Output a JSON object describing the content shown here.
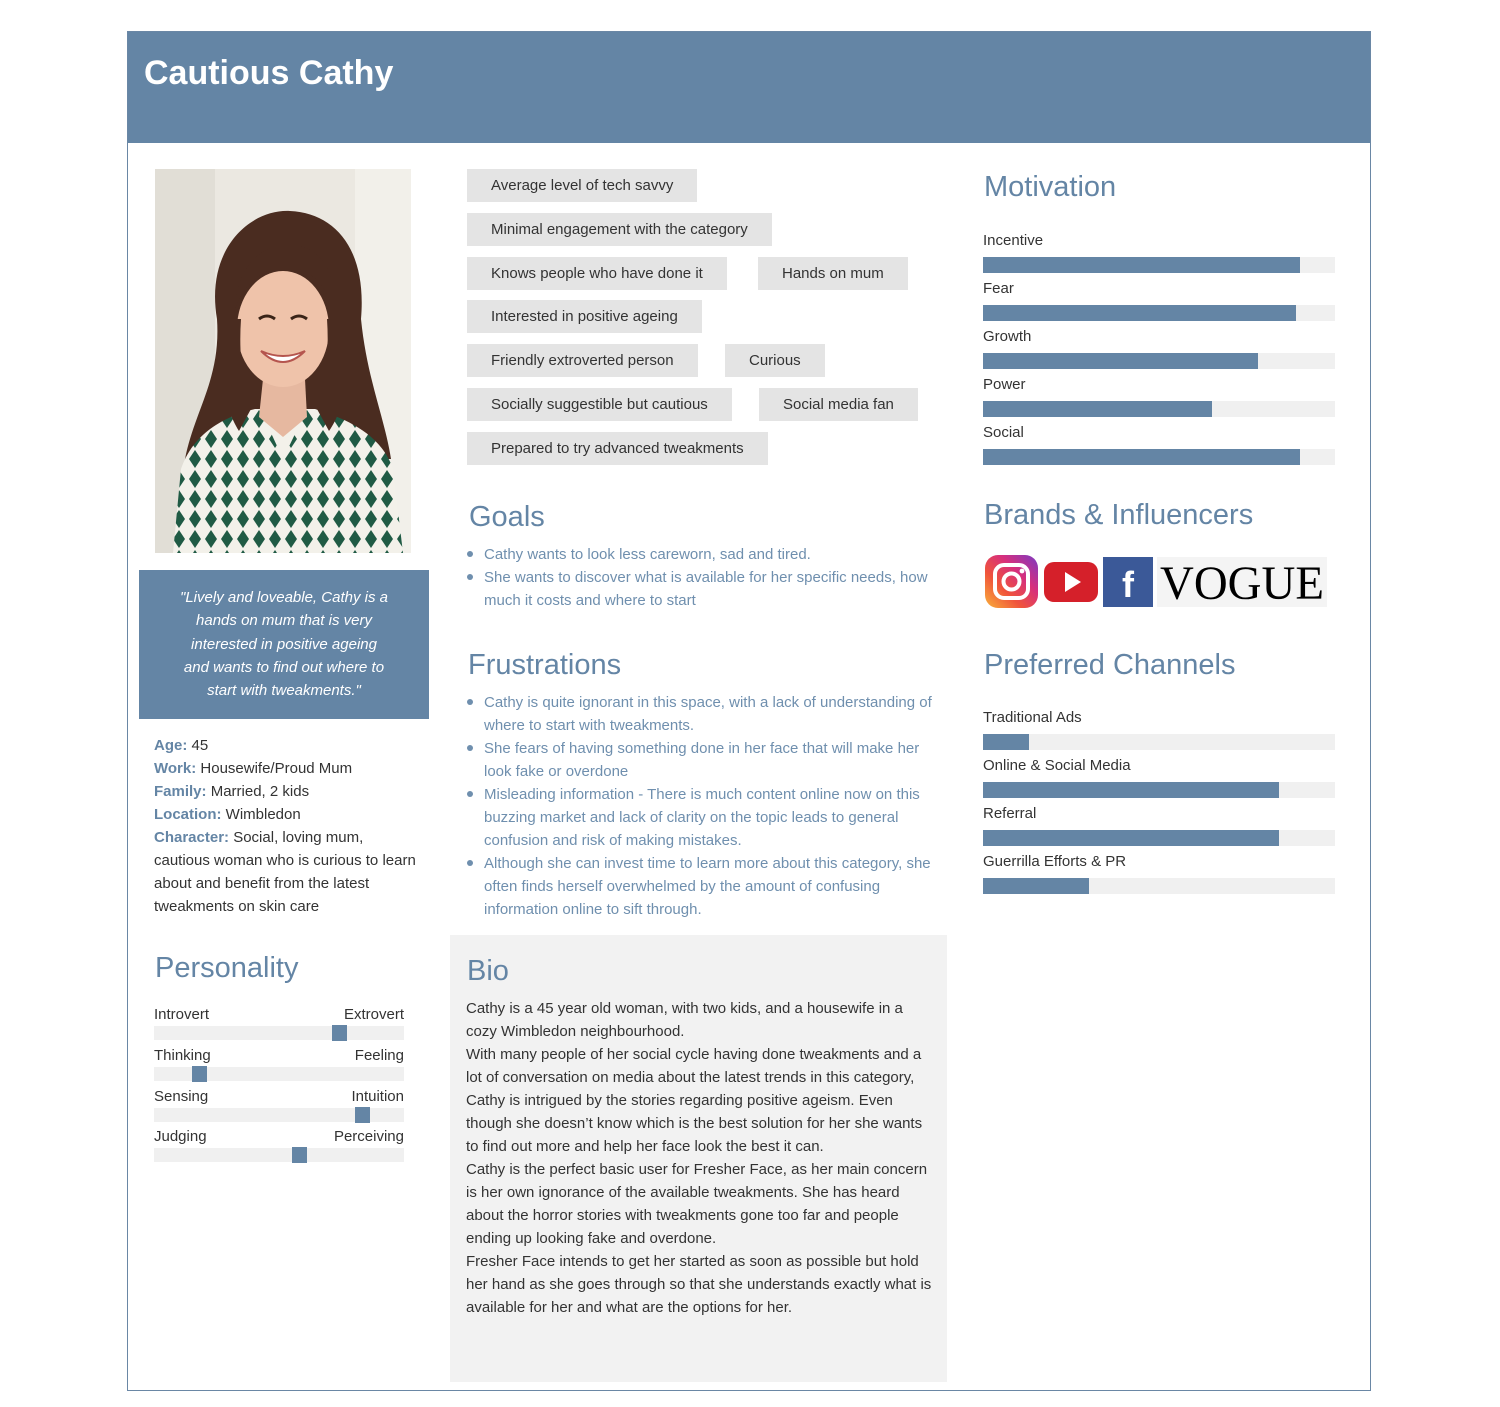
{
  "persona": {
    "name": "Cautious Cathy"
  },
  "quote": "\"Lively and loveable, Cathy is a hands on mum that is very interested in positive ageing and wants to find out where to start with tweakments.\"",
  "facts": [
    {
      "label": "Age",
      "value": " 45"
    },
    {
      "label": "Work",
      "value": " Housewife/Proud Mum"
    },
    {
      "label": "Family",
      "value": " Married, 2 kids"
    },
    {
      "label": "Location",
      "value": " Wimbledon"
    },
    {
      "label": "Character",
      "value": " Social, loving mum, cautious woman who is curious to learn about and benefit from the latest tweakments on skin care"
    }
  ],
  "personality": {
    "title": "Personality",
    "scales": [
      {
        "left": "Introvert",
        "right": "Extrovert",
        "value": 0.74
      },
      {
        "left": "Thinking",
        "right": "Feeling",
        "value": 0.18
      },
      {
        "left": "Sensing",
        "right": "Intuition",
        "value": 0.83
      },
      {
        "left": "Judging",
        "right": "Perceiving",
        "value": 0.58
      }
    ]
  },
  "tags": [
    "Average level of tech savvy",
    "Minimal engagement with the category",
    "Knows people who have done it",
    "Hands on mum",
    "Interested in positive ageing",
    "Friendly extroverted person",
    "Curious",
    "Socially suggestible but cautious",
    "Social media fan",
    "Prepared to try advanced tweakments"
  ],
  "goals": {
    "title": "Goals",
    "items": [
      "Cathy wants to look less careworn, sad and tired.",
      "She wants to discover what is available for her specific needs, how much it costs and where to start"
    ]
  },
  "frustrations": {
    "title": "Frustrations",
    "items": [
      "Cathy is quite ignorant in this space, with a lack of understanding of where to start with tweakments.",
      "She fears of having something done in her face that will make her look fake or overdone",
      "Misleading information - There is much content online now on this buzzing market and lack of clarity on the topic leads to general confusion and risk of making mistakes.",
      "Although she can invest time to learn more about this category, she often finds herself overwhelmed by the amount of confusing information online to sift through."
    ]
  },
  "bio": {
    "title": "Bio",
    "paragraphs": [
      "Cathy is a 45 year old woman, with two kids, and a housewife in a cozy Wimbledon neighbourhood.",
      "With many people of her social cycle having done tweakments and a lot of conversation on media about the latest trends in this category, Cathy is intrigued by the stories regarding positive ageism. Even though she doesn’t know which is the best solution for her she wants to find out more and help her face look the best it can.",
      "Cathy is the perfect basic user for Fresher Face, as her main concern is her own ignorance of the available tweakments. She has heard about the horror stories with tweakments gone too far and people ending up looking fake and overdone.",
      "Fresher Face intends to get her started as soon as possible but hold her hand as she goes through so that she understands exactly what is available for her and what are the options for her."
    ]
  },
  "motivation": {
    "title": "Motivation",
    "items": [
      {
        "label": "Incentive",
        "value": 0.9
      },
      {
        "label": "Fear",
        "value": 0.89
      },
      {
        "label": "Growth",
        "value": 0.78
      },
      {
        "label": "Power",
        "value": 0.65
      },
      {
        "label": "Social",
        "value": 0.9
      }
    ]
  },
  "brands": {
    "title": "Brands & Influencers",
    "logos": [
      "instagram-icon",
      "youtube-icon",
      "facebook-icon",
      "vogue-logo"
    ],
    "vogue_text": "VOGUE",
    "facebook_text": "f"
  },
  "channels": {
    "title": "Preferred Channels",
    "items": [
      {
        "label": "Traditional Ads",
        "value": 0.13
      },
      {
        "label": "Online & Social Media",
        "value": 0.84
      },
      {
        "label": "Referral",
        "value": 0.84
      },
      {
        "label": "Guerrilla Efforts & PR",
        "value": 0.3
      }
    ]
  },
  "colors": {
    "accent": "#6485a5",
    "tag_bg": "#e4e4e4",
    "track": "#f0f0f0",
    "bio_bg": "#f2f2f2"
  }
}
